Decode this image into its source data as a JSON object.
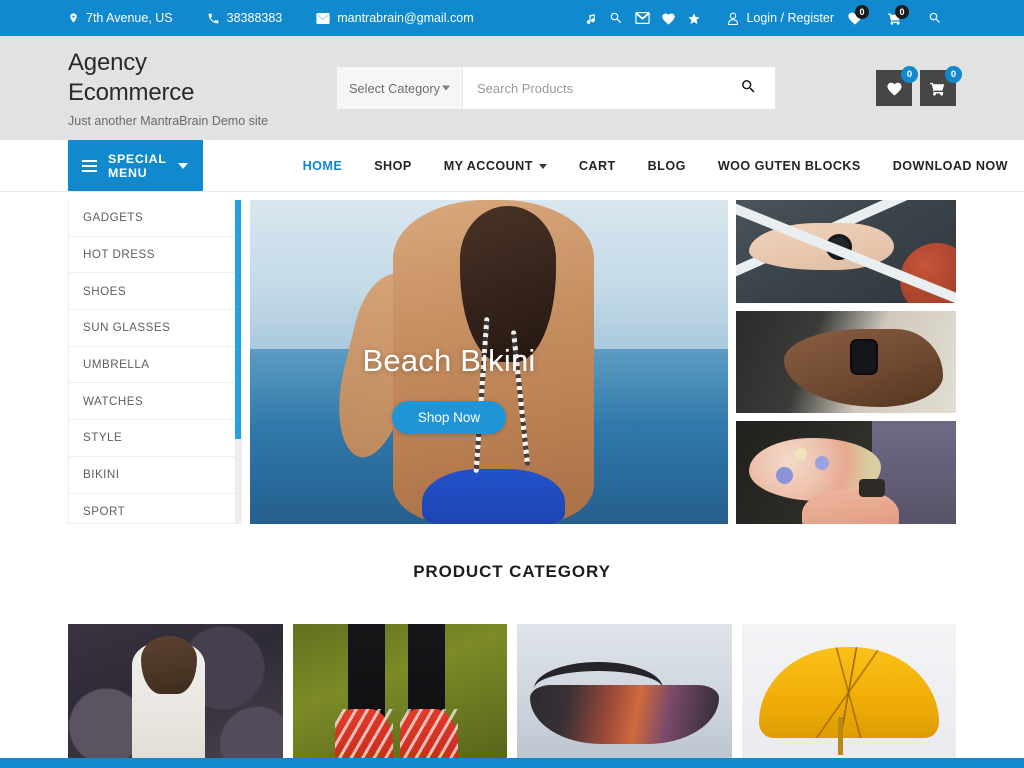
{
  "topbar": {
    "address": "7th Avenue, US",
    "phone": "38388383",
    "email": "mantrabrain@gmail.com",
    "login_label": "Login / Register",
    "wishlist_count": "0",
    "cart_count": "0",
    "icons": {
      "location": "location-pin-icon",
      "phone": "phone-icon",
      "mail": "envelope-icon",
      "music": "music-note-icon",
      "search": "search-icon",
      "message": "envelope-icon",
      "heart": "heart-icon",
      "star": "star-icon",
      "user": "user-icon",
      "wishlist": "heart-icon",
      "cart": "cart-icon",
      "search2": "search-icon"
    },
    "bg_color": "#1089ce"
  },
  "header": {
    "brand_line1": "Agency",
    "brand_line2": "Ecommerce",
    "tagline": "Just another MantraBrain Demo site",
    "search": {
      "category_label": "Select Category",
      "placeholder": "Search Products",
      "value": ""
    },
    "actions": {
      "wishlist_count": "0",
      "cart_count": "0"
    },
    "bg_color": "#e2e2e2"
  },
  "nav": {
    "special_menu_label": "SPECIAL MENU",
    "items": [
      {
        "label": "HOME",
        "active": true,
        "caret": false
      },
      {
        "label": "SHOP",
        "active": false,
        "caret": false
      },
      {
        "label": "MY ACCOUNT",
        "active": false,
        "caret": true
      },
      {
        "label": "CART",
        "active": false,
        "caret": false
      },
      {
        "label": "BLOG",
        "active": false,
        "caret": false
      },
      {
        "label": "WOO GUTEN BLOCKS",
        "active": false,
        "caret": false
      },
      {
        "label": "DOWNLOAD NOW",
        "active": false,
        "caret": false
      }
    ],
    "accent_color": "#1089ce"
  },
  "sidebar": {
    "categories": [
      "GADGETS",
      "HOT DRESS",
      "SHOES",
      "SUN GLASSES",
      "UMBRELLA",
      "WATCHES",
      "STYLE",
      "BIKINI",
      "SPORT"
    ],
    "scrollbar_color": "#22a3e0"
  },
  "slider": {
    "title": "Beach Bikini",
    "cta_label": "Shop Now",
    "cta_color": "#1f95d8"
  },
  "banners": [
    {
      "name": "watch-on-wrist-banner"
    },
    {
      "name": "smartwatch-banner"
    },
    {
      "name": "bouquet-watch-banner"
    }
  ],
  "product_category": {
    "title": "PRODUCT CATEGORY",
    "cards": [
      {
        "name": "category-hot-dress"
      },
      {
        "name": "category-shoes"
      },
      {
        "name": "category-sun-glasses"
      },
      {
        "name": "category-umbrella"
      }
    ]
  }
}
